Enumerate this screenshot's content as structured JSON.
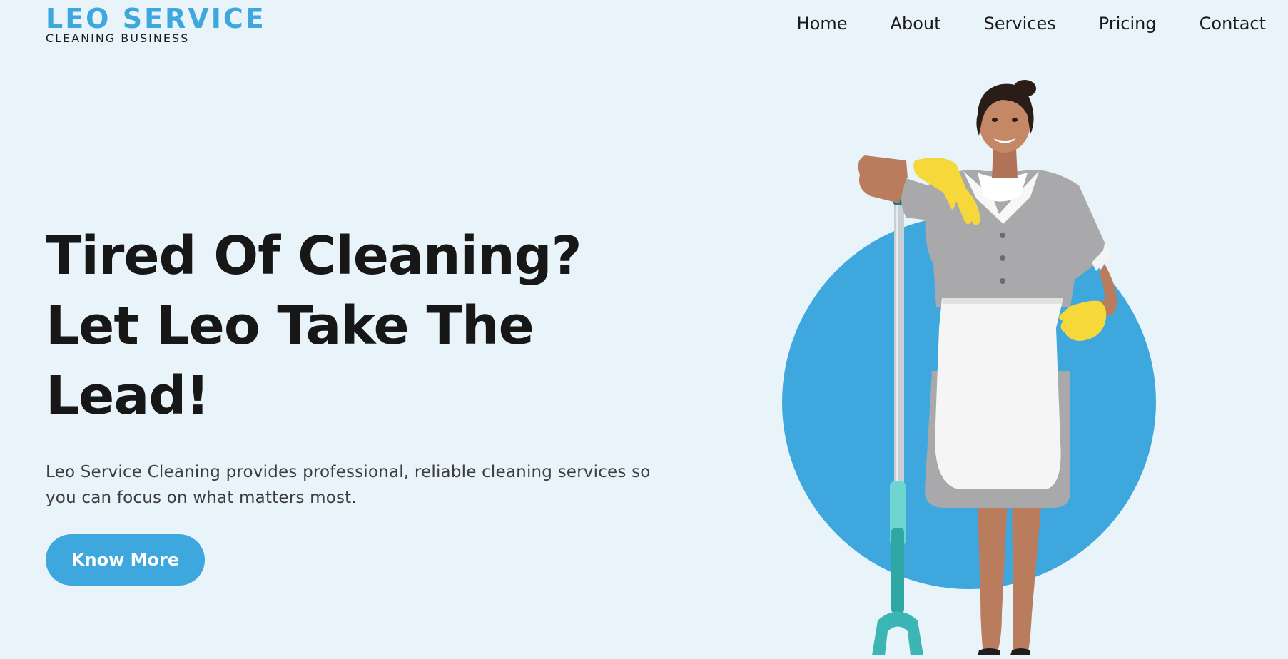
{
  "brand": {
    "title": "LEO SERVICE",
    "subtitle": "CLEANING BUSINESS",
    "accent_color": "#3ea7dd",
    "background_color": "#e8f3fa"
  },
  "nav": {
    "items": [
      {
        "label": "Home"
      },
      {
        "label": "About"
      },
      {
        "label": "Services"
      },
      {
        "label": "Pricing"
      },
      {
        "label": "Contact"
      }
    ]
  },
  "hero": {
    "headline_lines": [
      "Tired Of Cleaning?",
      "Let Leo Take The",
      "Lead!"
    ],
    "description": "Leo Service Cleaning provides professional, reliable cleaning services so you can focus on what matters most.",
    "cta_label": "Know More"
  },
  "illustration": {
    "subject": "cleaning-lady-with-mop",
    "circle_color": "#3ea7dd",
    "glove_color": "#f7d83a",
    "uniform_color": "#a9a9ab",
    "apron_color": "#f5f5f5",
    "mop_color": "#3bb6b4"
  }
}
